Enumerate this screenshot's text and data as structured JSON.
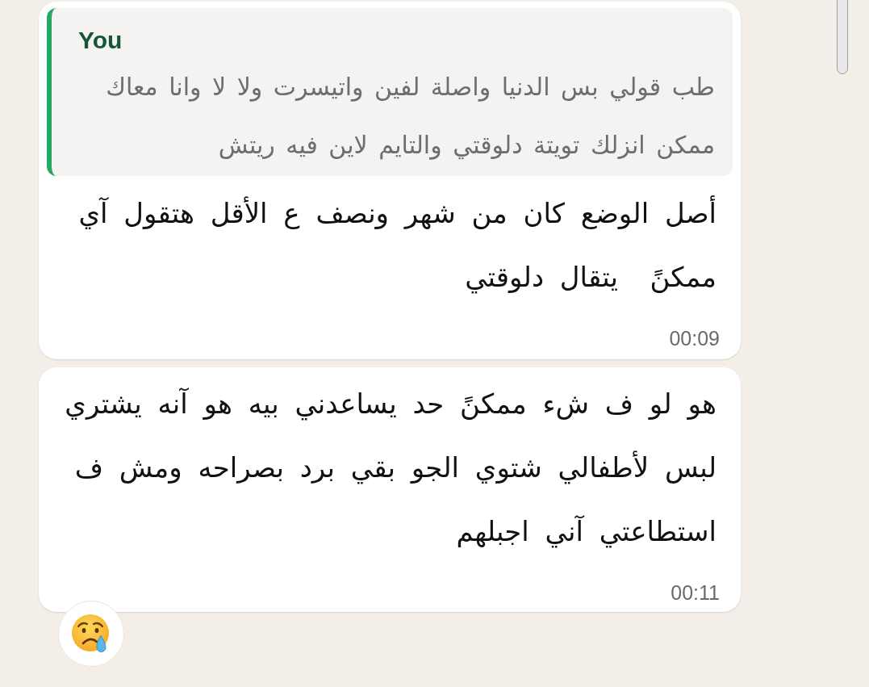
{
  "messages": [
    {
      "quote": {
        "author": "You",
        "text": "طب قولي بس الدنيا واصلة لفين واتيسرت ولا لا وانا معاك ممكن انزلك تويتة دلوقتي والتايم لاين فيه ريتش"
      },
      "text": "أصل الوضع كان من شهر ونصف ع الأقل هتقول آي ممكنً  يتقال دلوقتي",
      "time": "00:09",
      "reacted": false
    },
    {
      "text": "هو لو ف شء ممكنً حد يساعدني بيه هو آنه يشتري لبس لأطفالي شتوي الجو بقي برد بصراحه ومش ف استطاعتي آني اجبلهم",
      "time": "00:11",
      "reacted": true
    }
  ]
}
